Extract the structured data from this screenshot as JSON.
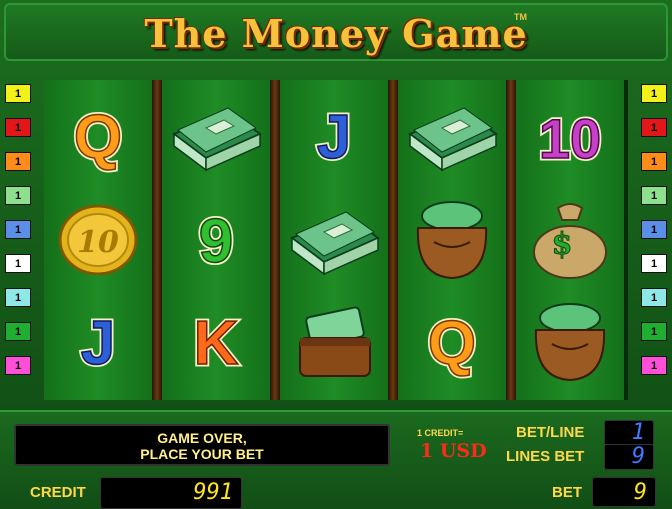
{
  "title": "The Money Game",
  "trademark": "TM",
  "line_buttons_left": [
    "1",
    "1",
    "1",
    "1",
    "1",
    "1",
    "1",
    "1",
    "1"
  ],
  "line_buttons_right": [
    "1",
    "1",
    "1",
    "1",
    "1",
    "1",
    "1",
    "1",
    "1"
  ],
  "line_colors": [
    "#f2f21a",
    "#e21818",
    "#ff8c1a",
    "#8ee08e",
    "#5b8ee6",
    "#ffffff",
    "#8ee8e8",
    "#1fae2f",
    "#ff4fd8"
  ],
  "reels": [
    [
      "Q",
      "10",
      "J"
    ],
    [
      "cash-stack",
      "9",
      "K"
    ],
    [
      "J",
      "cash-stack",
      "wallet"
    ],
    [
      "cash-stack",
      "money-bag",
      "Q"
    ],
    [
      "10",
      "dollar-sack",
      "money-bag"
    ]
  ],
  "status_message_line1": "GAME OVER,",
  "status_message_line2": "PLACE YOUR BET",
  "credit_label": "CREDIT",
  "credit_value": "991",
  "denomination_label": "1 CREDIT=",
  "denomination_value": "1 USD",
  "bet_per_line_label": "BET/LINE",
  "bet_per_line_value": "1",
  "lines_bet_label": "LINES BET",
  "lines_bet_value": "9",
  "bet_label": "BET",
  "bet_value": "9"
}
